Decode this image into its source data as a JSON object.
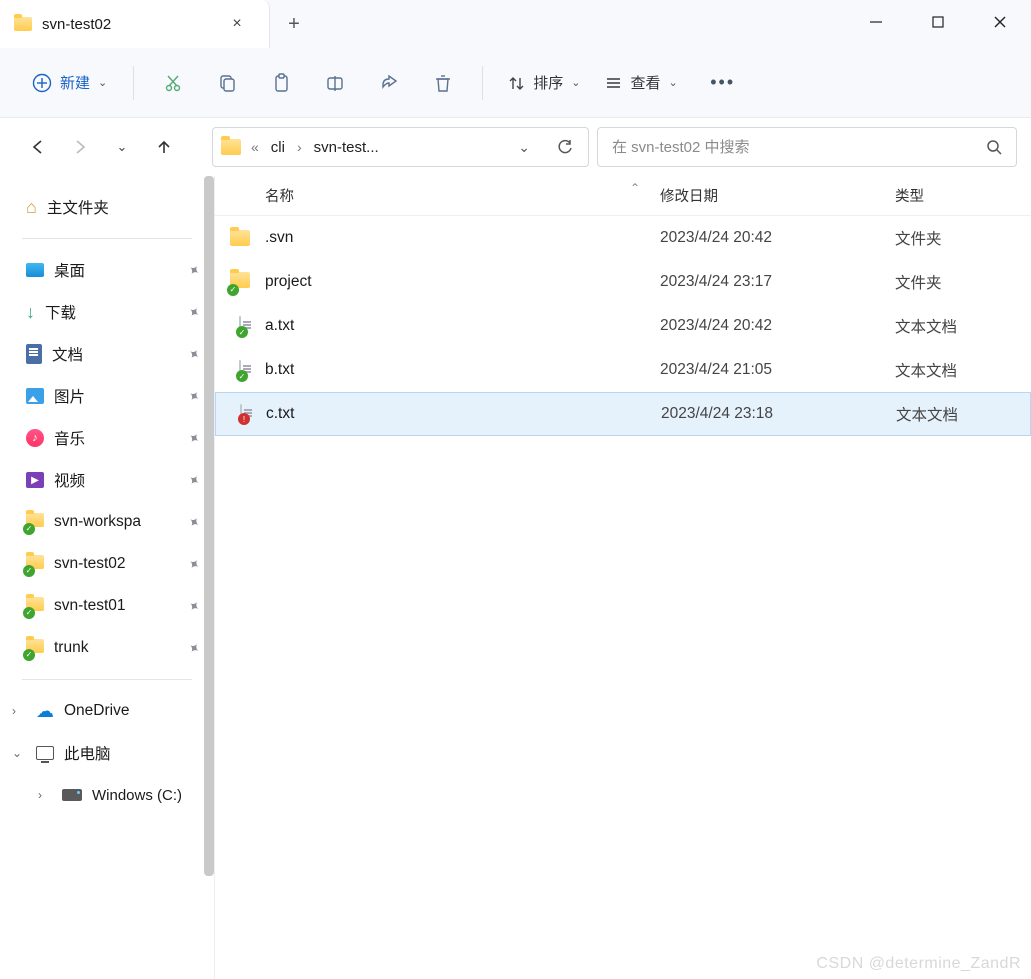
{
  "tab": {
    "title": "svn-test02"
  },
  "toolbar": {
    "new_label": "新建",
    "sort_label": "排序",
    "view_label": "查看"
  },
  "breadcrumb": {
    "overflow": "«",
    "parts": [
      "cli",
      "svn-test..."
    ]
  },
  "search": {
    "placeholder": "在 svn-test02 中搜索"
  },
  "sidebar": {
    "home": "主文件夹",
    "quick": [
      {
        "label": "桌面"
      },
      {
        "label": "下载"
      },
      {
        "label": "文档"
      },
      {
        "label": "图片"
      },
      {
        "label": "音乐"
      },
      {
        "label": "视频"
      },
      {
        "label": "svn-workspa"
      },
      {
        "label": "svn-test02"
      },
      {
        "label": "svn-test01"
      },
      {
        "label": "trunk"
      }
    ],
    "onedrive": "OneDrive",
    "thispc": "此电脑",
    "drive": "Windows (C:)"
  },
  "columns": {
    "name": "名称",
    "date": "修改日期",
    "type": "类型"
  },
  "files": [
    {
      "name": ".svn",
      "date": "2023/4/24 20:42",
      "type": "文件夹",
      "icon": "folder",
      "selected": false
    },
    {
      "name": "project",
      "date": "2023/4/24 23:17",
      "type": "文件夹",
      "icon": "folder-svn",
      "selected": false
    },
    {
      "name": "a.txt",
      "date": "2023/4/24 20:42",
      "type": "文本文档",
      "icon": "txt-svn",
      "selected": false
    },
    {
      "name": "b.txt",
      "date": "2023/4/24 21:05",
      "type": "文本文档",
      "icon": "txt-svn",
      "selected": false
    },
    {
      "name": "c.txt",
      "date": "2023/4/24 23:18",
      "type": "文本文档",
      "icon": "txt-svn-bad",
      "selected": true
    }
  ],
  "watermark": "CSDN @determine_ZandR"
}
